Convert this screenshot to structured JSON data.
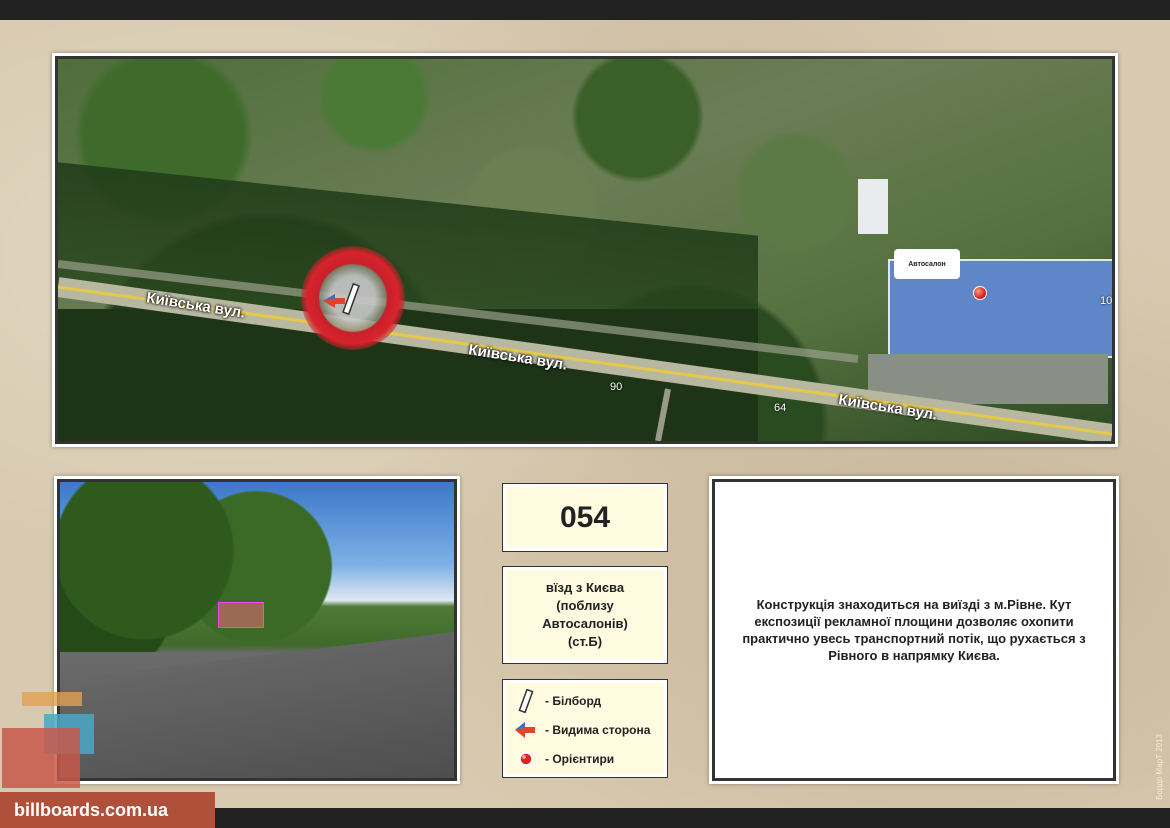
{
  "map": {
    "road_labels": [
      "Київська вул.",
      "Київська вул.",
      "Київська вул."
    ],
    "numbers": [
      "90",
      "64",
      "10"
    ],
    "landmark_callout": "Автосалон"
  },
  "board": {
    "code": "054",
    "address_lines": [
      "вїзд з Києва",
      "(поблизу",
      "Автосалонів)",
      "(ст.Б)"
    ]
  },
  "legend": {
    "items": [
      {
        "label": "- Білборд",
        "icon": "billboard-icon"
      },
      {
        "label": "- Видима сторона",
        "icon": "visible-side-arrow-icon"
      },
      {
        "label": "- Орієнтири",
        "icon": "landmark-dot-icon"
      }
    ]
  },
  "description": "Конструкція знаходиться на виїзді з м.Рівне. Кут експозиції рекламної площини дозволяє охопити практично увесь транспортний потік, що рухається з Рівного в напрямку Києва.",
  "watermark": "billboards.com.ua",
  "credit": "Бордо МарТ 2013",
  "colors": {
    "accent_red": "#d8232c",
    "paper": "#d8cab0",
    "box_fill": "#fffbe0"
  }
}
